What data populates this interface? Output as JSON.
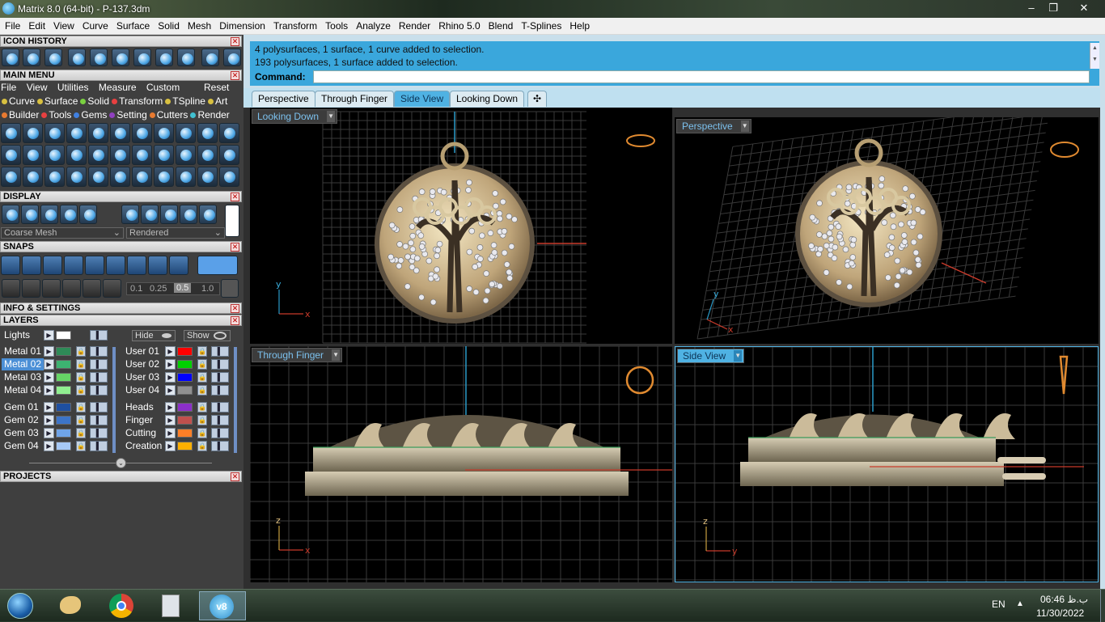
{
  "window": {
    "title": "Matrix 8.0 (64-bit) - P-137.3dm",
    "controls": {
      "minimize": "–",
      "restore": "❐",
      "close": "✕"
    }
  },
  "menubar": [
    "File",
    "Edit",
    "View",
    "Curve",
    "Surface",
    "Solid",
    "Mesh",
    "Dimension",
    "Transform",
    "Tools",
    "Analyze",
    "Render",
    "Rhino 5.0",
    "Blend",
    "T-Splines",
    "Help"
  ],
  "left": {
    "icon_history": "ICON HISTORY",
    "main_menu": "MAIN MENU",
    "main_menu_items": [
      "File",
      "View",
      "Utilities",
      "Measure",
      "Custom"
    ],
    "reset": "Reset",
    "cat_row1": [
      {
        "label": "Curve",
        "color": "#d8c040"
      },
      {
        "label": "Surface",
        "color": "#d8c040"
      },
      {
        "label": "Solid",
        "color": "#7ad040"
      },
      {
        "label": "Transform",
        "color": "#e84040"
      },
      {
        "label": "TSpline",
        "color": "#d8c040"
      },
      {
        "label": "Art",
        "color": "#d8c040"
      }
    ],
    "cat_row2": [
      {
        "label": "Builder",
        "color": "#e87a30"
      },
      {
        "label": "Tools",
        "color": "#e84040"
      },
      {
        "label": "Gems",
        "color": "#4080e0"
      },
      {
        "label": "Setting",
        "color": "#9040c0"
      },
      {
        "label": "Cutters",
        "color": "#e87a30"
      },
      {
        "label": "Render",
        "color": "#40c0d0"
      }
    ],
    "display": "DISPLAY",
    "mesh_select": "Coarse Mesh",
    "render_select": "Rendered",
    "snaps": "SNAPS",
    "snap_values": [
      "0.1",
      "0.25",
      "0.5",
      "1.0"
    ],
    "info_settings": "INFO & SETTINGS",
    "layers": "LAYERS",
    "lights": "Lights",
    "hide": "Hide",
    "show": "Show",
    "layers_left": [
      {
        "name": "Metal 01",
        "color": "#2e8b57"
      },
      {
        "name": "Metal 02",
        "color": "#3cb371"
      },
      {
        "name": "Metal 03",
        "color": "#66d566"
      },
      {
        "name": "Metal 04",
        "color": "#90ee90"
      },
      {
        "name": "Gem 01",
        "color": "#1e4fa0"
      },
      {
        "name": "Gem 02",
        "color": "#3c74c8"
      },
      {
        "name": "Gem 03",
        "color": "#6fa4e8"
      },
      {
        "name": "Gem 04",
        "color": "#a6c8f5"
      }
    ],
    "layers_right": [
      {
        "name": "User 01",
        "color": "#ff0000"
      },
      {
        "name": "User 02",
        "color": "#00d000"
      },
      {
        "name": "User 03",
        "color": "#0000ff"
      },
      {
        "name": "User 04",
        "color": "#909090"
      },
      {
        "name": "Heads",
        "color": "#8b2fc9"
      },
      {
        "name": "Finger",
        "color": "#c0504d"
      },
      {
        "name": "Cutting",
        "color": "#ff7f27"
      },
      {
        "name": "Creation",
        "color": "#ffb000"
      }
    ],
    "projects": "PROJECTS"
  },
  "command": {
    "line1": "4 polysurfaces, 1 surface, 1 curve added to selection.",
    "line2": "193 polysurfaces, 1 surface added to selection.",
    "label": "Command:"
  },
  "view_tabs": [
    "Perspective",
    "Through Finger",
    "Side View",
    "Looking Down"
  ],
  "active_tab": "Side View",
  "viewports": {
    "top_left": "Looking Down",
    "top_right": "Perspective",
    "bottom_left": "Through Finger",
    "bottom_right": "Side View"
  },
  "axes": {
    "x": "x",
    "y": "y",
    "z": "z"
  },
  "taskbar": {
    "lang": "EN",
    "time": "06:46 ب.ظ",
    "date": "11/30/2022"
  }
}
